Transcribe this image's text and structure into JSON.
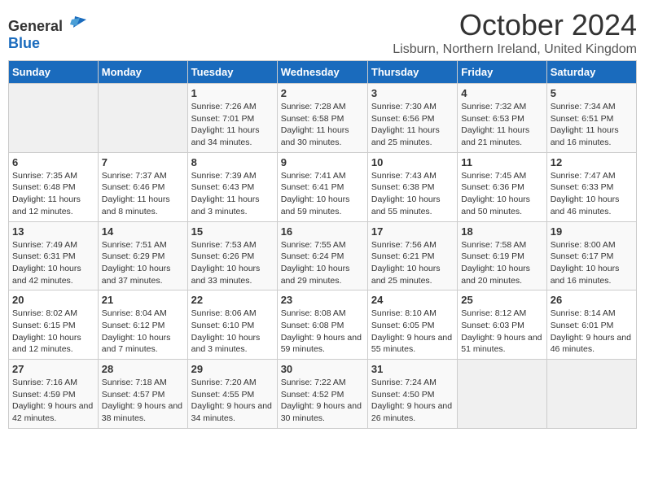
{
  "header": {
    "logo_general": "General",
    "logo_blue": "Blue",
    "title": "October 2024",
    "location": "Lisburn, Northern Ireland, United Kingdom"
  },
  "days_of_week": [
    "Sunday",
    "Monday",
    "Tuesday",
    "Wednesday",
    "Thursday",
    "Friday",
    "Saturday"
  ],
  "weeks": [
    [
      {
        "day": null
      },
      {
        "day": null
      },
      {
        "day": 1,
        "sunrise": "Sunrise: 7:26 AM",
        "sunset": "Sunset: 7:01 PM",
        "daylight": "Daylight: 11 hours and 34 minutes."
      },
      {
        "day": 2,
        "sunrise": "Sunrise: 7:28 AM",
        "sunset": "Sunset: 6:58 PM",
        "daylight": "Daylight: 11 hours and 30 minutes."
      },
      {
        "day": 3,
        "sunrise": "Sunrise: 7:30 AM",
        "sunset": "Sunset: 6:56 PM",
        "daylight": "Daylight: 11 hours and 25 minutes."
      },
      {
        "day": 4,
        "sunrise": "Sunrise: 7:32 AM",
        "sunset": "Sunset: 6:53 PM",
        "daylight": "Daylight: 11 hours and 21 minutes."
      },
      {
        "day": 5,
        "sunrise": "Sunrise: 7:34 AM",
        "sunset": "Sunset: 6:51 PM",
        "daylight": "Daylight: 11 hours and 16 minutes."
      }
    ],
    [
      {
        "day": 6,
        "sunrise": "Sunrise: 7:35 AM",
        "sunset": "Sunset: 6:48 PM",
        "daylight": "Daylight: 11 hours and 12 minutes."
      },
      {
        "day": 7,
        "sunrise": "Sunrise: 7:37 AM",
        "sunset": "Sunset: 6:46 PM",
        "daylight": "Daylight: 11 hours and 8 minutes."
      },
      {
        "day": 8,
        "sunrise": "Sunrise: 7:39 AM",
        "sunset": "Sunset: 6:43 PM",
        "daylight": "Daylight: 11 hours and 3 minutes."
      },
      {
        "day": 9,
        "sunrise": "Sunrise: 7:41 AM",
        "sunset": "Sunset: 6:41 PM",
        "daylight": "Daylight: 10 hours and 59 minutes."
      },
      {
        "day": 10,
        "sunrise": "Sunrise: 7:43 AM",
        "sunset": "Sunset: 6:38 PM",
        "daylight": "Daylight: 10 hours and 55 minutes."
      },
      {
        "day": 11,
        "sunrise": "Sunrise: 7:45 AM",
        "sunset": "Sunset: 6:36 PM",
        "daylight": "Daylight: 10 hours and 50 minutes."
      },
      {
        "day": 12,
        "sunrise": "Sunrise: 7:47 AM",
        "sunset": "Sunset: 6:33 PM",
        "daylight": "Daylight: 10 hours and 46 minutes."
      }
    ],
    [
      {
        "day": 13,
        "sunrise": "Sunrise: 7:49 AM",
        "sunset": "Sunset: 6:31 PM",
        "daylight": "Daylight: 10 hours and 42 minutes."
      },
      {
        "day": 14,
        "sunrise": "Sunrise: 7:51 AM",
        "sunset": "Sunset: 6:29 PM",
        "daylight": "Daylight: 10 hours and 37 minutes."
      },
      {
        "day": 15,
        "sunrise": "Sunrise: 7:53 AM",
        "sunset": "Sunset: 6:26 PM",
        "daylight": "Daylight: 10 hours and 33 minutes."
      },
      {
        "day": 16,
        "sunrise": "Sunrise: 7:55 AM",
        "sunset": "Sunset: 6:24 PM",
        "daylight": "Daylight: 10 hours and 29 minutes."
      },
      {
        "day": 17,
        "sunrise": "Sunrise: 7:56 AM",
        "sunset": "Sunset: 6:21 PM",
        "daylight": "Daylight: 10 hours and 25 minutes."
      },
      {
        "day": 18,
        "sunrise": "Sunrise: 7:58 AM",
        "sunset": "Sunset: 6:19 PM",
        "daylight": "Daylight: 10 hours and 20 minutes."
      },
      {
        "day": 19,
        "sunrise": "Sunrise: 8:00 AM",
        "sunset": "Sunset: 6:17 PM",
        "daylight": "Daylight: 10 hours and 16 minutes."
      }
    ],
    [
      {
        "day": 20,
        "sunrise": "Sunrise: 8:02 AM",
        "sunset": "Sunset: 6:15 PM",
        "daylight": "Daylight: 10 hours and 12 minutes."
      },
      {
        "day": 21,
        "sunrise": "Sunrise: 8:04 AM",
        "sunset": "Sunset: 6:12 PM",
        "daylight": "Daylight: 10 hours and 7 minutes."
      },
      {
        "day": 22,
        "sunrise": "Sunrise: 8:06 AM",
        "sunset": "Sunset: 6:10 PM",
        "daylight": "Daylight: 10 hours and 3 minutes."
      },
      {
        "day": 23,
        "sunrise": "Sunrise: 8:08 AM",
        "sunset": "Sunset: 6:08 PM",
        "daylight": "Daylight: 9 hours and 59 minutes."
      },
      {
        "day": 24,
        "sunrise": "Sunrise: 8:10 AM",
        "sunset": "Sunset: 6:05 PM",
        "daylight": "Daylight: 9 hours and 55 minutes."
      },
      {
        "day": 25,
        "sunrise": "Sunrise: 8:12 AM",
        "sunset": "Sunset: 6:03 PM",
        "daylight": "Daylight: 9 hours and 51 minutes."
      },
      {
        "day": 26,
        "sunrise": "Sunrise: 8:14 AM",
        "sunset": "Sunset: 6:01 PM",
        "daylight": "Daylight: 9 hours and 46 minutes."
      }
    ],
    [
      {
        "day": 27,
        "sunrise": "Sunrise: 7:16 AM",
        "sunset": "Sunset: 4:59 PM",
        "daylight": "Daylight: 9 hours and 42 minutes."
      },
      {
        "day": 28,
        "sunrise": "Sunrise: 7:18 AM",
        "sunset": "Sunset: 4:57 PM",
        "daylight": "Daylight: 9 hours and 38 minutes."
      },
      {
        "day": 29,
        "sunrise": "Sunrise: 7:20 AM",
        "sunset": "Sunset: 4:55 PM",
        "daylight": "Daylight: 9 hours and 34 minutes."
      },
      {
        "day": 30,
        "sunrise": "Sunrise: 7:22 AM",
        "sunset": "Sunset: 4:52 PM",
        "daylight": "Daylight: 9 hours and 30 minutes."
      },
      {
        "day": 31,
        "sunrise": "Sunrise: 7:24 AM",
        "sunset": "Sunset: 4:50 PM",
        "daylight": "Daylight: 9 hours and 26 minutes."
      },
      {
        "day": null
      },
      {
        "day": null
      }
    ]
  ]
}
